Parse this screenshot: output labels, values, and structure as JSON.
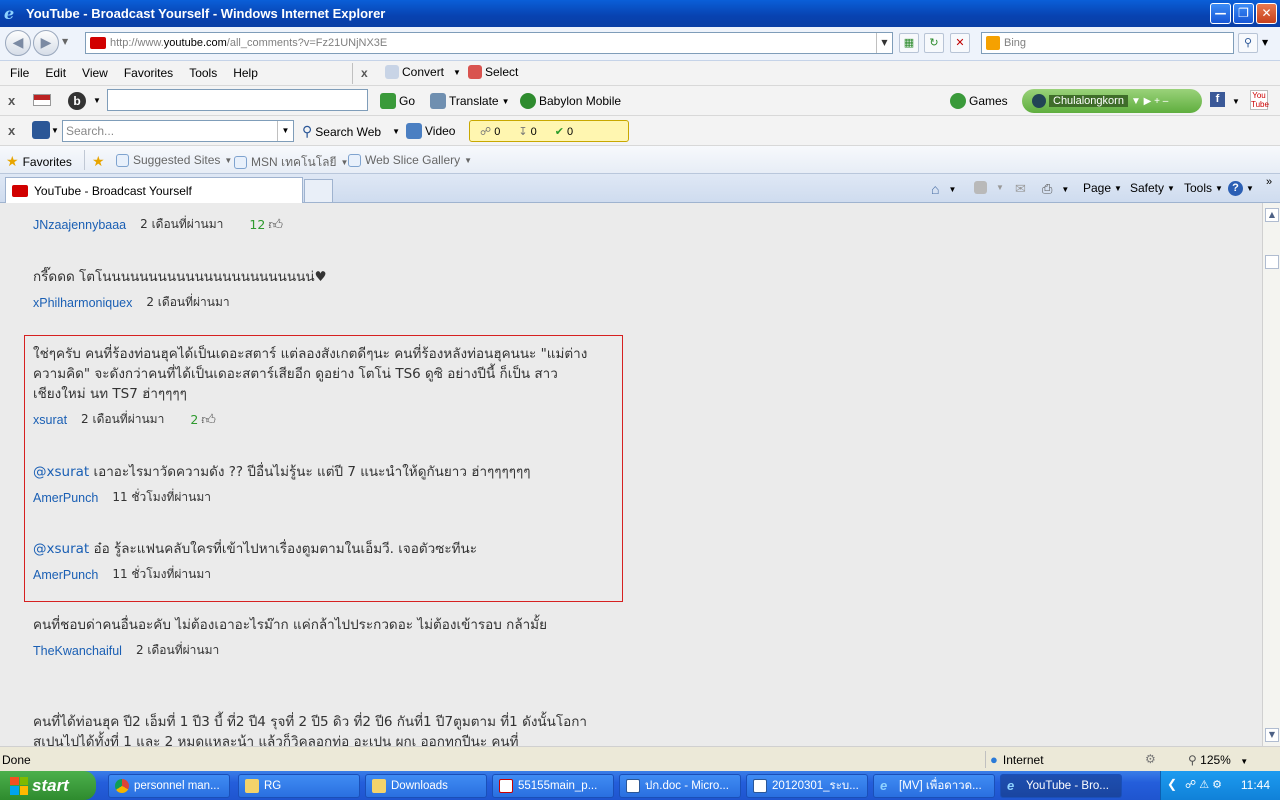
{
  "window": {
    "title": "YouTube - Broadcast Yourself - Windows Internet Explorer"
  },
  "address": {
    "url_prefix": "http://www.",
    "url_host": "youtube.com",
    "url_path": "/all_comments?v=Fz21UNjNX3E",
    "search_placeholder": "Bing"
  },
  "menu": [
    "File",
    "Edit",
    "View",
    "Favorites",
    "Tools",
    "Help"
  ],
  "menu_right": {
    "convert": "Convert",
    "select": "Select"
  },
  "babylon_bar": {
    "go": "Go",
    "translate": "Translate",
    "mobile": "Babylon Mobile",
    "games": "Games",
    "chula": "Chulalongkorn"
  },
  "search_bar": {
    "placeholder": "Search...",
    "search_web": "Search Web",
    "video": "Video",
    "counts": [
      "0",
      "0",
      "0"
    ]
  },
  "favorites_bar": {
    "favorites": "Favorites",
    "items": [
      "Suggested Sites",
      "MSN เทคโนโลยี",
      "Web Slice Gallery"
    ]
  },
  "tab": {
    "label": "YouTube - Broadcast Yourself"
  },
  "commands": {
    "page": "Page",
    "safety": "Safety",
    "tools": "Tools"
  },
  "comments": [
    {
      "user": "JNzaajennybaaa",
      "time": "2 เดือนที่ผ่านมา",
      "likes": "12"
    },
    {
      "text": "กรี๊ดดด โตโนนนนนนนนนนนนนนนนนนนนนนน่♥",
      "user": "xPhilharmoniquex",
      "time": "2 เดือนที่ผ่านมา"
    },
    {
      "text": "ใช่ๆครับ คนที่ร้องท่อนฮุคได้เป็นเดอะสตาร์ แต่ลองสังเกตดีๆนะ คนที่ร้องหลังท่อนฮุคนนะ \"แม่ต่างความคิด\" จะดังกว่าคนที่ได้เป็นเดอะสตาร์เสียอีก ดูอย่าง โตโน่ TS6 ดูซิ อย่างปีนี้ ก็เป็น สาวเชียงใหม่ นท TS7 ฮ่าๆๆๆๆ",
      "user": "xsurat",
      "time": "2 เดือนที่ผ่านมา",
      "likes": "2"
    },
    {
      "mention": "@xsurat",
      "text": " เอาอะไรมาวัดความดัง ?? ปีอื่นไม่รู้นะ แต่ปี 7 แนะนำให้ดูกันยาว ฮ่าๆๆๆๆๆๆ",
      "user": "AmerPunch",
      "time": "11 ชั่วโมงที่ผ่านมา"
    },
    {
      "mention": "@xsurat",
      "text": " อ๋อ รู้ละแฟนคลับใครที่เข้าไปหาเรื่องตูมตามในเอ็มวี. เจอตัวซะทีนะ",
      "user": "AmerPunch",
      "time": "11 ชั่วโมงที่ผ่านมา"
    },
    {
      "text": "คนที่ชอบด่าคนอื่นอะคับ ไม่ต้องเอาอะไรม๊าก แค่กล้าไปประกวดอะ ไม่ต้องเข้ารอบ กล้ามั้ย",
      "user": "TheKwanchaiful",
      "time": "2 เดือนที่ผ่านมา"
    },
    {
      "text": "คนที่ได้ท่อนฮุค ปี2 เอ็มที่ 1 ปี3 บี้ ที่2 ปี4 รุจที่ 2 ปี5 ดิว ที่2 ปี6 กันที่1 ปี7ตูมตาม ที่1 ดังนั้นโอกาสเปนไปได้ทั้งที่ 1 และ 2 หมดแหละน้า แล้วก็วิคลอกท่อ อะเปน ผกเ ออกทุกปีนะ คนที่"
    }
  ],
  "status": {
    "left": "Done",
    "zone": "Internet",
    "zoom": "125%"
  },
  "taskbar": {
    "start": "start",
    "items": [
      "personnel man...",
      "RG",
      "Downloads",
      "55155main_p...",
      "ปก.doc - Micro...",
      "20120301_ระบ...",
      "[MV] เพื่อดาวด...",
      "YouTube - Bro..."
    ],
    "clock": "11:44"
  },
  "colors": {
    "accent": "#1a5fb4",
    "highlight_border": "#d62020",
    "likes": "#2f9a2f"
  }
}
